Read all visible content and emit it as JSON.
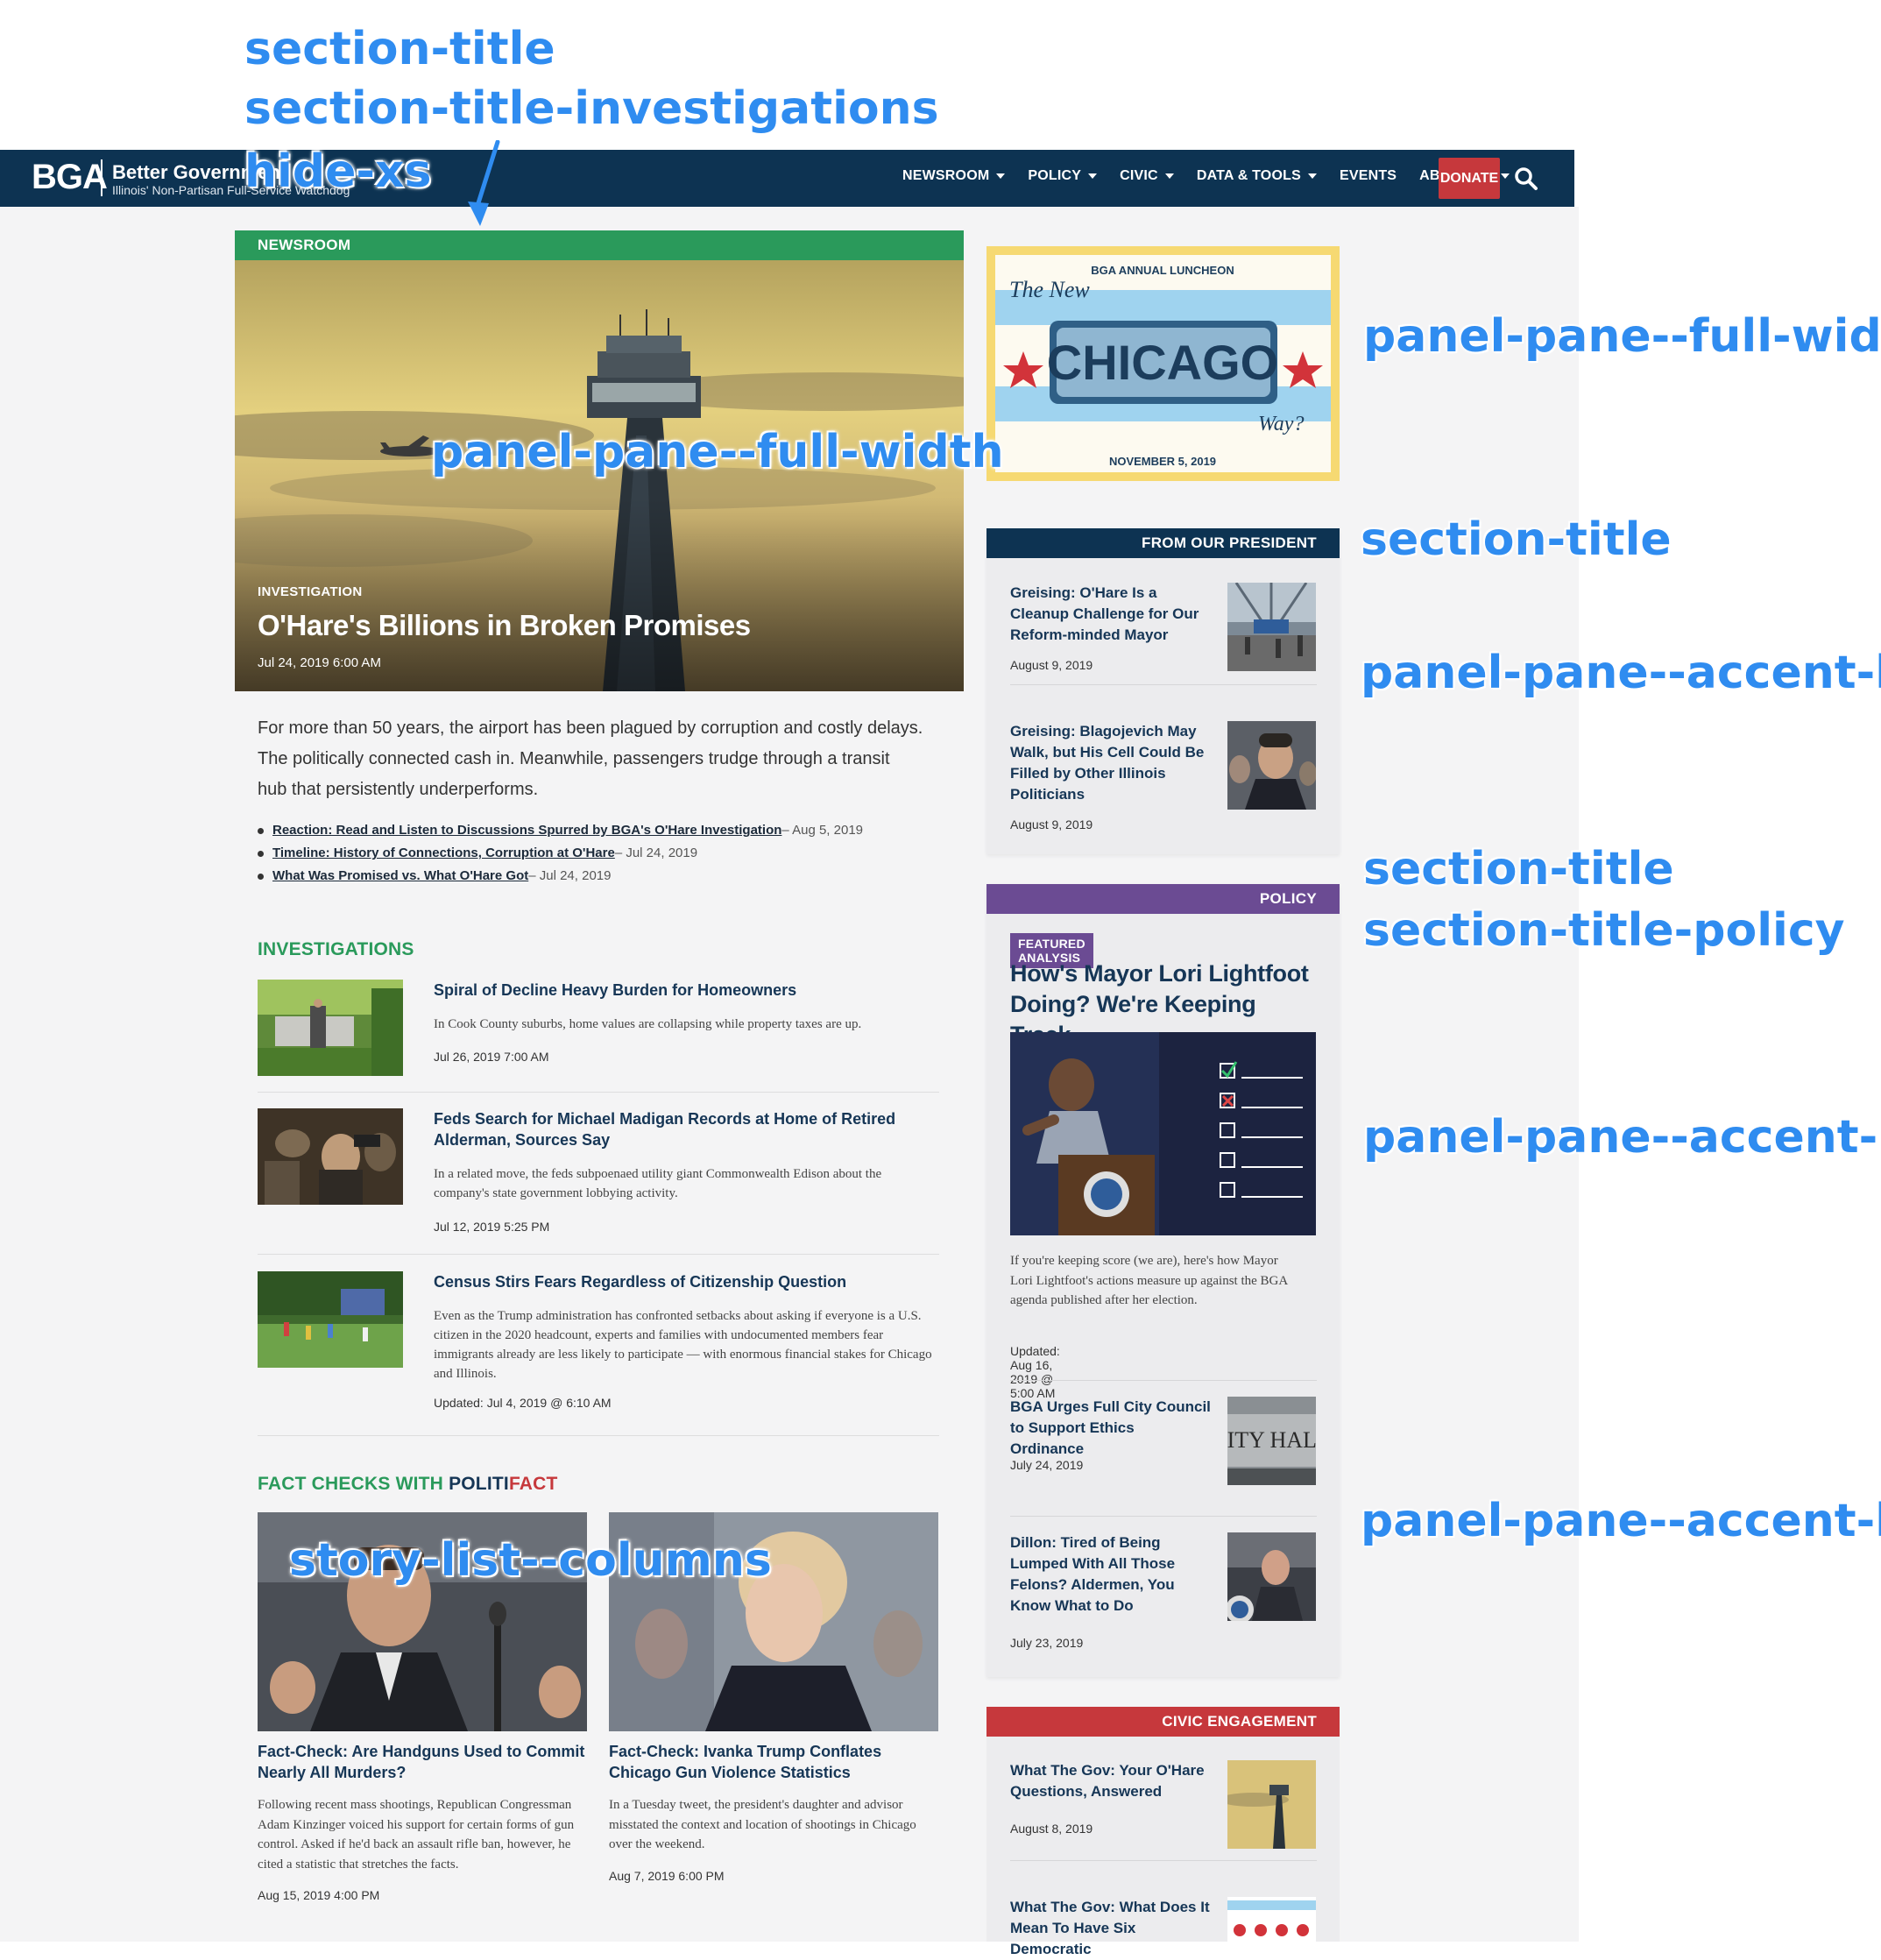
{
  "annotations": {
    "section_title_top": "section-title",
    "section_title_investigations": "section-title-investigations",
    "hide_xs": "hide-xs",
    "full_width_hero": "panel-pane--full-width",
    "full_width_luncheon": "panel-pane--full-width",
    "section_title_president": "section-title",
    "accent_bg_president": "panel-pane--accent-bg",
    "section_title_policy_a": "section-title",
    "section_title_policy_b": "section-title-policy",
    "accent_bg_policy": "panel-pane--accent-bg",
    "accent_bg_policy_lower": "panel-pane--accent-bg",
    "story_list_columns": "story-list--columns"
  },
  "header": {
    "logo": "BGA",
    "name": "Better Governmen",
    "tagline": "Illinois' Non-Partisan Full-Service Watchdog",
    "nav": [
      "NEWSROOM",
      "POLICY",
      "CIVIC",
      "DATA & TOOLS",
      "EVENTS",
      "ABOUT US"
    ],
    "nav_has_caret": [
      true,
      true,
      true,
      true,
      false,
      true
    ],
    "donate": "DONATE"
  },
  "newsroom": {
    "section": "NEWSROOM",
    "kicker": "INVESTIGATION",
    "title": "O'Hare's Billions in Broken Promises",
    "date": "Jul 24, 2019 6:00 AM",
    "lede": "For more than 50 years, the airport has been plagued by corruption and costly delays. The politically connected cash in. Meanwhile, passengers trudge through a transit hub that persistently underperforms.",
    "related": [
      {
        "link": "Reaction: Read and Listen to Discussions Spurred by BGA's O'Hare Investigation",
        "date": " – Aug 5, 2019"
      },
      {
        "link": "Timeline: History of Connections, Corruption at O'Hare",
        "date": " – Jul 24, 2019"
      },
      {
        "link": "What Was Promised vs. What O'Hare Got",
        "date": " – Jul 24, 2019"
      }
    ]
  },
  "investigations": {
    "label": "INVESTIGATIONS",
    "stories": [
      {
        "title": "Spiral of Decline Heavy Burden for Homeowners",
        "desc": "In Cook County suburbs, home values are collapsing while property taxes are up.",
        "date": "Jul 26, 2019 7:00 AM"
      },
      {
        "title": "Feds Search for Michael Madigan Records at Home of Retired Alderman, Sources Say",
        "desc": "In a related move, the feds subpoenaed utility giant Commonwealth Edison about the company's state government lobbying activity.",
        "date": "Jul 12, 2019 5:25 PM"
      },
      {
        "title": "Census Stirs Fears Regardless of Citizenship Question",
        "desc": "Even as the Trump administration has confronted setbacks about asking if everyone is a U.S. citizen in the 2020 headcount, experts and families with undocumented members fear immigrants already are less likely to participate — with enormous financial stakes for Chicago and Illinois.",
        "date": "Updated: Jul 4, 2019 @ 6:10 AM"
      }
    ]
  },
  "factchecks": {
    "label_prefix": "FACT CHECKS WITH ",
    "brand_a": "POLITI",
    "brand_b": "FACT",
    "items": [
      {
        "title": "Fact-Check: Are Handguns Used to Commit Nearly All Murders?",
        "desc": "Following recent mass shootings, Republican Congressman Adam Kinzinger voiced his support for certain forms of gun control. Asked if he'd back an assault rifle ban, however, he cited a statistic that stretches the facts.",
        "date": "Aug 15, 2019 4:00 PM"
      },
      {
        "title": "Fact-Check: Ivanka Trump Conflates Chicago Gun Violence Statistics",
        "desc": "In a Tuesday tweet, the president's daughter and advisor misstated the context and location of shootings in Chicago over the weekend.",
        "date": "Aug 7, 2019 6:00 PM"
      }
    ]
  },
  "luncheon": {
    "top": "BGA ANNUAL LUNCHEON",
    "the_new": "The New",
    "city": "CHICAGO",
    "way": "Way?",
    "date": "NOVEMBER 5, 2019"
  },
  "president": {
    "label": "FROM OUR PRESIDENT",
    "items": [
      {
        "title": "Greising: O'Hare Is a Cleanup Challenge for Our Reform-minded Mayor",
        "date": "August 9, 2019"
      },
      {
        "title": "Greising: Blagojevich May Walk, but His Cell Could Be Filled by Other Illinois Politicians",
        "date": "August 9, 2019"
      }
    ]
  },
  "policy": {
    "label": "POLICY",
    "badge": "FEATURED ANALYSIS",
    "feature_title": "How's Mayor Lori Lightfoot Doing? We're Keeping Track.",
    "feature_desc": "If you're keeping score (we are), here's how Mayor Lori Lightfoot's actions measure up against the BGA agenda published after her election.",
    "feature_date": "Updated: Aug 16, 2019 @ 5:00 AM",
    "items": [
      {
        "title": "BGA Urges Full City Council to Support Ethics Ordinance",
        "date": "July 24, 2019"
      },
      {
        "title": "Dillon: Tired of Being Lumped With All Those Felons? Aldermen, You Know What to Do",
        "date": "July 23, 2019"
      }
    ]
  },
  "civic": {
    "label": "CIVIC ENGAGEMENT",
    "items": [
      {
        "title": "What The Gov: Your O'Hare Questions, Answered",
        "date": "August 8, 2019"
      },
      {
        "title": "What The Gov: What Does It Mean To Have Six Democratic",
        "date": ""
      }
    ]
  },
  "colors": {
    "navy": "#0d3352",
    "green": "#2a9a5b",
    "purple": "#6b4b93",
    "red": "#c6383c",
    "annotation": "#2f8cf0"
  }
}
